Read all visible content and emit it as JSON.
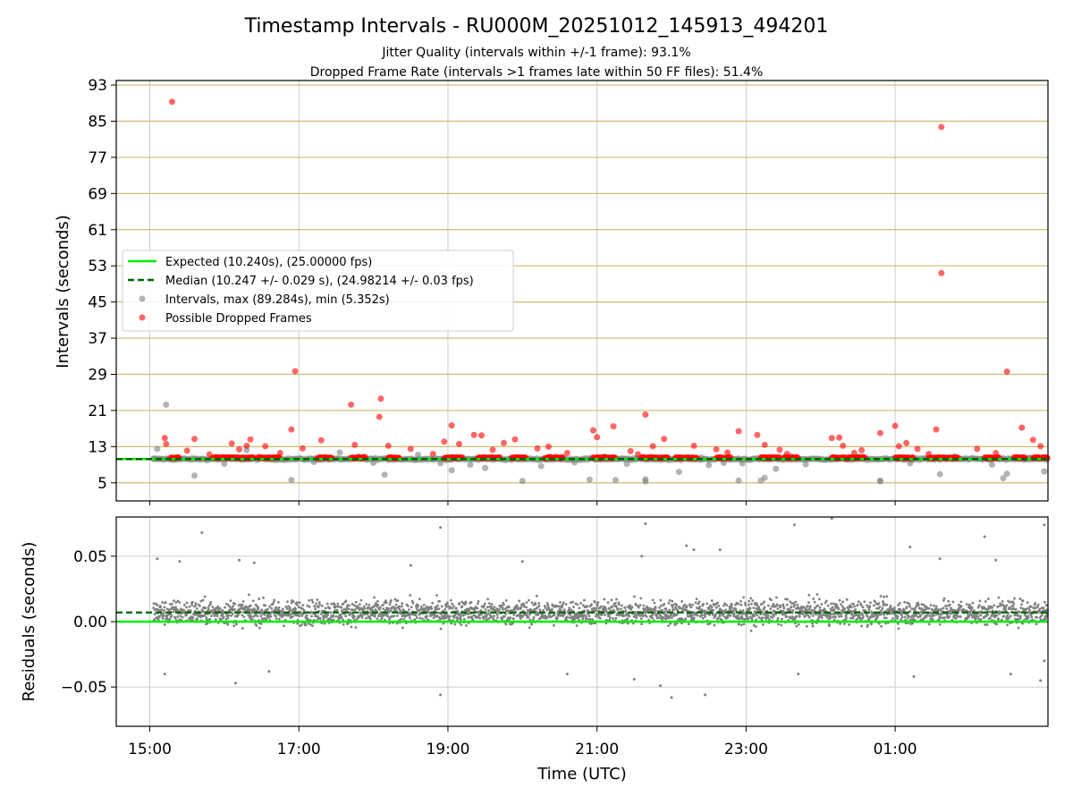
{
  "colors": {
    "expected": "#00ee00",
    "median": "#006400",
    "interval_marker": "#808080",
    "dropped_marker": "#ff0000",
    "upper_grid": "#d2b96e",
    "lower_grid": "#cccccc"
  },
  "chart_data": [
    {
      "type": "scatter",
      "title": "Timestamp Intervals - RU000M_20251012_145913_494201",
      "subtitle_1": "Jitter Quality (intervals within +/-1 frame): 93.1%",
      "subtitle_2": "Dropped Frame Rate (intervals >1 frames late within 50 FF files): 51.4%",
      "ylabel": "Intervals (seconds)",
      "ylim": [
        1,
        94
      ],
      "yticks": [
        "93",
        "85",
        "77",
        "69",
        "61",
        "53",
        "45",
        "37",
        "29",
        "21",
        "13",
        "5"
      ],
      "ytick_values": [
        93,
        85,
        77,
        69,
        61,
        53,
        45,
        37,
        29,
        21,
        13,
        5
      ],
      "xlim_hours": [
        14.55,
        27.05
      ],
      "legend": {
        "placement": "center-left",
        "expected": "Expected (10.240s), (25.00000 fps)",
        "median": "Median (10.247 +/- 0.029 s), (24.98214 +/- 0.03 fps)",
        "intervals": "Intervals, max (89.284s), min (5.352s)",
        "dropped": "Possible Dropped Frames"
      },
      "expected_value": 10.24,
      "median_value": 10.247,
      "dropped_points": [
        [
          15.3,
          89.3
        ],
        [
          25.62,
          83.7
        ],
        [
          25.62,
          51.4
        ],
        [
          16.95,
          29.7
        ],
        [
          26.5,
          29.6
        ],
        [
          18.1,
          23.6
        ],
        [
          17.7,
          22.3
        ],
        [
          18.08,
          19.6
        ],
        [
          21.65,
          20.1
        ],
        [
          19.05,
          17.7
        ],
        [
          16.9,
          16.8
        ],
        [
          20.95,
          16.6
        ],
        [
          21.22,
          17.5
        ],
        [
          22.9,
          16.4
        ],
        [
          25.0,
          17.6
        ],
        [
          25.55,
          16.8
        ],
        [
          26.7,
          17.2
        ],
        [
          15.2,
          14.9
        ],
        [
          15.6,
          14.7
        ],
        [
          16.35,
          14.6
        ],
        [
          17.3,
          14.4
        ],
        [
          19.35,
          15.6
        ],
        [
          19.45,
          15.5
        ],
        [
          19.9,
          14.6
        ],
        [
          21.0,
          15.1
        ],
        [
          21.9,
          14.7
        ],
        [
          23.15,
          15.6
        ],
        [
          24.15,
          14.9
        ],
        [
          24.25,
          15.0
        ],
        [
          24.8,
          16.0
        ],
        [
          25.15,
          13.8
        ],
        [
          26.85,
          14.5
        ],
        [
          15.22,
          13.6
        ],
        [
          16.1,
          13.7
        ],
        [
          16.3,
          13.2
        ],
        [
          16.55,
          13.1
        ],
        [
          17.75,
          13.4
        ],
        [
          18.2,
          13.2
        ],
        [
          18.95,
          14.1
        ],
        [
          19.15,
          13.6
        ],
        [
          19.75,
          13.8
        ],
        [
          20.35,
          13.0
        ],
        [
          21.75,
          13.1
        ],
        [
          22.3,
          13.2
        ],
        [
          23.25,
          13.4
        ],
        [
          24.3,
          13.2
        ],
        [
          25.05,
          13.1
        ],
        [
          26.95,
          13.1
        ],
        [
          15.5,
          12.1
        ],
        [
          16.2,
          12.4
        ],
        [
          17.05,
          12.6
        ],
        [
          18.5,
          12.5
        ],
        [
          19.6,
          12.3
        ],
        [
          20.2,
          12.6
        ],
        [
          21.45,
          12.0
        ],
        [
          22.6,
          12.4
        ],
        [
          23.45,
          12.3
        ],
        [
          24.55,
          12.2
        ],
        [
          25.3,
          12.5
        ],
        [
          26.1,
          12.5
        ],
        [
          15.8,
          11.3
        ],
        [
          16.75,
          11.6
        ],
        [
          18.8,
          11.4
        ],
        [
          20.6,
          11.6
        ],
        [
          21.55,
          11.3
        ],
        [
          22.75,
          11.7
        ],
        [
          23.55,
          11.4
        ],
        [
          24.45,
          11.6
        ],
        [
          25.45,
          11.4
        ],
        [
          26.35,
          11.6
        ]
      ],
      "dropped_bands": [
        [
          15.28,
          15.4
        ],
        [
          15.85,
          16.4
        ],
        [
          16.45,
          16.75
        ],
        [
          17.25,
          17.45
        ],
        [
          17.7,
          17.9
        ],
        [
          18.2,
          18.35
        ],
        [
          18.95,
          19.2
        ],
        [
          19.4,
          19.7
        ],
        [
          19.85,
          20.05
        ],
        [
          20.3,
          20.55
        ],
        [
          20.95,
          21.25
        ],
        [
          21.6,
          21.95
        ],
        [
          22.05,
          22.35
        ],
        [
          22.6,
          22.8
        ],
        [
          23.2,
          23.45
        ],
        [
          23.5,
          23.7
        ],
        [
          24.15,
          24.6
        ],
        [
          25.0,
          25.25
        ],
        [
          25.45,
          25.85
        ],
        [
          26.2,
          26.4
        ],
        [
          26.6,
          26.75
        ],
        [
          26.85,
          27.05
        ]
      ],
      "interval_points": [
        [
          15.22,
          22.3
        ],
        [
          15.1,
          12.5
        ],
        [
          16.3,
          12.2
        ],
        [
          17.55,
          11.7
        ],
        [
          18.6,
          11.2
        ],
        [
          19.05,
          7.8
        ],
        [
          18.9,
          9.3
        ],
        [
          19.5,
          8.3
        ],
        [
          20.25,
          8.7
        ],
        [
          20.0,
          5.4
        ],
        [
          20.9,
          5.7
        ],
        [
          21.25,
          5.6
        ],
        [
          21.65,
          5.3
        ],
        [
          21.65,
          5.8
        ],
        [
          22.1,
          7.4
        ],
        [
          22.5,
          8.9
        ],
        [
          22.95,
          9.3
        ],
        [
          22.9,
          5.5
        ],
        [
          23.2,
          5.5
        ],
        [
          23.25,
          6.1
        ],
        [
          23.4,
          8.1
        ],
        [
          24.8,
          5.5
        ],
        [
          24.8,
          5.3
        ],
        [
          25.6,
          6.9
        ],
        [
          26.45,
          6.0
        ],
        [
          26.5,
          7.0
        ],
        [
          27.0,
          7.5
        ],
        [
          15.6,
          6.6
        ],
        [
          16.9,
          5.6
        ],
        [
          18.15,
          6.8
        ],
        [
          16.0,
          9.2
        ],
        [
          17.2,
          9.6
        ],
        [
          18.0,
          9.4
        ],
        [
          19.3,
          9.0
        ],
        [
          20.7,
          9.5
        ],
        [
          21.4,
          9.2
        ],
        [
          22.7,
          9.4
        ],
        [
          23.8,
          9.1
        ],
        [
          25.2,
          9.3
        ],
        [
          26.3,
          9.0
        ],
        [
          15.05,
          10.3
        ],
        [
          16.5,
          10.5
        ],
        [
          17.8,
          10.8
        ],
        [
          19.7,
          10.6
        ],
        [
          21.1,
          10.8
        ],
        [
          22.4,
          10.6
        ],
        [
          23.6,
          10.9
        ],
        [
          24.5,
          10.7
        ],
        [
          25.8,
          10.8
        ],
        [
          26.8,
          10.6
        ]
      ],
      "interval_bands": [
        [
          15.05,
          27.05
        ]
      ]
    },
    {
      "type": "scatter",
      "ylabel": "Residuals (seconds)",
      "xlabel": "Time (UTC)",
      "ylim": [
        -0.08,
        0.08
      ],
      "yticks": [
        "0.05",
        "0.00",
        "−0.05"
      ],
      "ytick_values": [
        0.05,
        0.0,
        -0.05
      ],
      "xticks": [
        "15:00",
        "17:00",
        "19:00",
        "21:00",
        "23:00",
        "01:00"
      ],
      "xtick_hours": [
        15,
        17,
        19,
        21,
        23,
        25
      ],
      "expected_value": 0.0,
      "median_value": 0.007,
      "residual_center": 0.007,
      "residual_spread": 0.01,
      "residual_outliers": [
        [
          15.7,
          0.068
        ],
        [
          18.9,
          0.072
        ],
        [
          21.65,
          0.075
        ],
        [
          23.65,
          0.074
        ],
        [
          24.15,
          0.079
        ],
        [
          26.2,
          0.065
        ],
        [
          27.0,
          0.074
        ],
        [
          15.1,
          0.048
        ],
        [
          15.4,
          0.046
        ],
        [
          16.2,
          0.047
        ],
        [
          16.4,
          0.045
        ],
        [
          18.5,
          0.043
        ],
        [
          20.0,
          0.046
        ],
        [
          21.6,
          0.05
        ],
        [
          22.2,
          0.058
        ],
        [
          22.3,
          0.055
        ],
        [
          22.65,
          0.055
        ],
        [
          25.2,
          0.057
        ],
        [
          25.6,
          0.048
        ],
        [
          26.35,
          0.047
        ],
        [
          15.2,
          -0.04
        ],
        [
          16.15,
          -0.047
        ],
        [
          16.6,
          -0.038
        ],
        [
          18.9,
          -0.056
        ],
        [
          20.6,
          -0.04
        ],
        [
          21.5,
          -0.044
        ],
        [
          21.85,
          -0.049
        ],
        [
          22.0,
          -0.058
        ],
        [
          22.45,
          -0.056
        ],
        [
          23.7,
          -0.04
        ],
        [
          25.25,
          -0.042
        ],
        [
          26.55,
          -0.04
        ],
        [
          26.95,
          -0.045
        ],
        [
          27.0,
          -0.03
        ]
      ]
    }
  ]
}
